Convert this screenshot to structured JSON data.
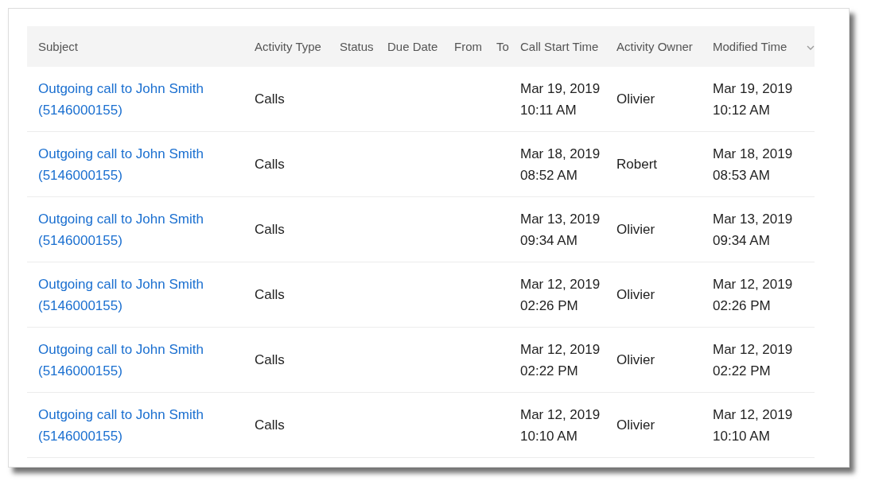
{
  "table": {
    "columns": [
      {
        "label": "Subject"
      },
      {
        "label": "Activity Type"
      },
      {
        "label": "Status"
      },
      {
        "label": "Due Date"
      },
      {
        "label": "From"
      },
      {
        "label": "To"
      },
      {
        "label": "Call Start Time"
      },
      {
        "label": "Activity Owner"
      },
      {
        "label": "Modified Time",
        "menu": true
      }
    ],
    "rows": [
      {
        "subject": "Outgoing call to John Smith (5146000155)",
        "activity_type": "Calls",
        "call_start_time": "Mar 19, 2019 10:11 AM",
        "activity_owner": "Olivier",
        "modified_time": "Mar 19, 2019 10:12 AM"
      },
      {
        "subject": "Outgoing call to John Smith (5146000155)",
        "activity_type": "Calls",
        "call_start_time": "Mar 18, 2019 08:52 AM",
        "activity_owner": "Robert",
        "modified_time": "Mar 18, 2019 08:53 AM"
      },
      {
        "subject": "Outgoing call to John Smith (5146000155)",
        "activity_type": "Calls",
        "call_start_time": "Mar 13, 2019 09:34 AM",
        "activity_owner": "Olivier",
        "modified_time": "Mar 13, 2019 09:34 AM"
      },
      {
        "subject": "Outgoing call to John Smith (5146000155)",
        "activity_type": "Calls",
        "call_start_time": "Mar 12, 2019 02:26 PM",
        "activity_owner": "Olivier",
        "modified_time": "Mar 12, 2019 02:26 PM"
      },
      {
        "subject": "Outgoing call to John Smith (5146000155)",
        "activity_type": "Calls",
        "call_start_time": "Mar 12, 2019 02:22 PM",
        "activity_owner": "Olivier",
        "modified_time": "Mar 12, 2019 02:22 PM"
      },
      {
        "subject": "Outgoing call to John Smith (5146000155)",
        "activity_type": "Calls",
        "call_start_time": "Mar 12, 2019 10:10 AM",
        "activity_owner": "Olivier",
        "modified_time": "Mar 12, 2019 10:10 AM"
      }
    ]
  }
}
